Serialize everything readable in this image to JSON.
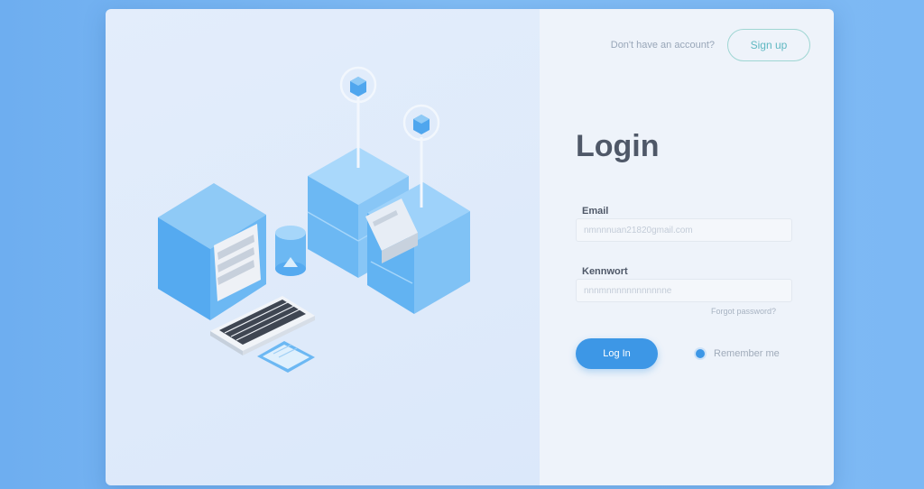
{
  "header": {
    "signup_prompt": "Don't have an account?",
    "signup_label": "Sign up"
  },
  "form": {
    "title": "Login",
    "email_label": "Email",
    "email_placeholder": "nmnnnuan21820gmail.com",
    "password_label": "Kennwort",
    "password_placeholder": "nnnmnnnnnnnnnnnne",
    "forgot_label": "Forgot password?",
    "login_label": "Log In",
    "remember_label": "Remember me"
  },
  "colors": {
    "accent": "#3d97e6",
    "signup_border": "#9fd6d3",
    "background": "#7cb8f4"
  },
  "icons": {
    "illustration": "isometric-server-cabinet-keyboard-illustration"
  }
}
